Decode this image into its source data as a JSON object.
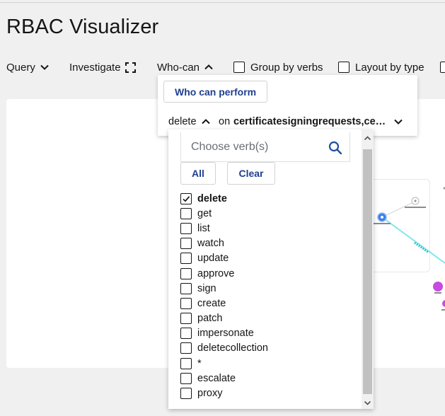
{
  "app": {
    "title": "RBAC Visualizer"
  },
  "toolbar": {
    "query_label": "Query",
    "investigate_label": "Investigate",
    "whocan_label": "Who-can",
    "group_by_verbs_label": "Group by verbs",
    "layout_by_type_label": "Layout by type"
  },
  "popover": {
    "who_can_button": "Who can perform",
    "verb_value": "delete",
    "on_label": "on",
    "resource_value": "certificatesigningrequests,certi..."
  },
  "verb_dropdown": {
    "search_placeholder": "Choose verb(s)",
    "all_label": "All",
    "clear_label": "Clear",
    "options": [
      {
        "label": "delete",
        "checked": true
      },
      {
        "label": "get",
        "checked": false
      },
      {
        "label": "list",
        "checked": false
      },
      {
        "label": "watch",
        "checked": false
      },
      {
        "label": "update",
        "checked": false
      },
      {
        "label": "approve",
        "checked": false
      },
      {
        "label": "sign",
        "checked": false
      },
      {
        "label": "create",
        "checked": false
      },
      {
        "label": "patch",
        "checked": false
      },
      {
        "label": "impersonate",
        "checked": false
      },
      {
        "label": "deletecollection",
        "checked": false
      },
      {
        "label": "*",
        "checked": false
      },
      {
        "label": "escalate",
        "checked": false
      },
      {
        "label": "proxy",
        "checked": false
      }
    ]
  },
  "colors": {
    "accent": "#1f3f8f",
    "node_blue": "#3f7fe8",
    "node_purple": "#c74be0",
    "edge_cyan": "#7fe6ea"
  }
}
